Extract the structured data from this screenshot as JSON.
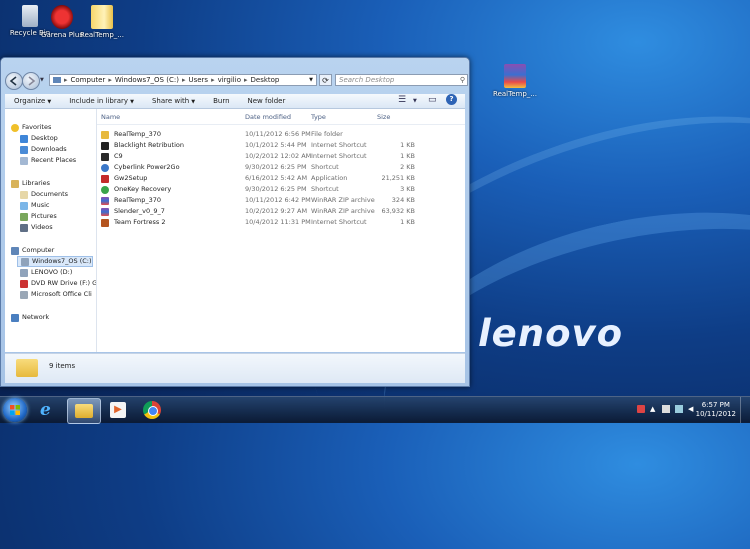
{
  "desktop": {
    "icons": [
      {
        "label": "Recycle Bin"
      },
      {
        "label": "Garena Plus"
      },
      {
        "label": "RealTemp_..."
      },
      {
        "label": "RealTemp_..."
      }
    ],
    "wallpaper_text": "lenovo"
  },
  "window": {
    "address": [
      "Computer",
      "Windows7_OS (C:)",
      "Users",
      "virgilio",
      "Desktop"
    ],
    "search_placeholder": "Search Desktop",
    "toolbar": {
      "organize": "Organize",
      "include": "Include in library",
      "share": "Share with",
      "burn": "Burn",
      "new_folder": "New folder"
    },
    "nav": {
      "favorites": "Favorites",
      "desktop": "Desktop",
      "downloads": "Downloads",
      "recent": "Recent Places",
      "libraries": "Libraries",
      "documents": "Documents",
      "music": "Music",
      "pictures": "Pictures",
      "videos": "Videos",
      "computer": "Computer",
      "c_drive": "Windows7_OS (C:)",
      "d_drive": "LENOVO (D:)",
      "f_drive": "DVD RW Drive (F:) G",
      "office": "Microsoft Office Cli",
      "network": "Network"
    },
    "columns": {
      "name": "Name",
      "date": "Date modified",
      "type": "Type",
      "size": "Size"
    },
    "files": [
      {
        "name": "RealTemp_370",
        "date": "10/11/2012 6:56 PM",
        "type": "File folder",
        "size": ""
      },
      {
        "name": "Blacklight Retribution",
        "date": "10/1/2012 5:44 PM",
        "type": "Internet Shortcut",
        "size": "1 KB"
      },
      {
        "name": "C9",
        "date": "10/2/2012 12:02 AM",
        "type": "Internet Shortcut",
        "size": "1 KB"
      },
      {
        "name": "Cyberlink Power2Go",
        "date": "9/30/2012 6:25 PM",
        "type": "Shortcut",
        "size": "2 KB"
      },
      {
        "name": "Gw2Setup",
        "date": "6/16/2012 5:42 AM",
        "type": "Application",
        "size": "21,251 KB"
      },
      {
        "name": "OneKey Recovery",
        "date": "9/30/2012 6:25 PM",
        "type": "Shortcut",
        "size": "3 KB"
      },
      {
        "name": "RealTemp_370",
        "date": "10/11/2012 6:42 PM",
        "type": "WinRAR ZIP archive",
        "size": "324 KB"
      },
      {
        "name": "Slender_v0_9_7",
        "date": "10/2/2012 9:27 AM",
        "type": "WinRAR ZIP archive",
        "size": "63,932 KB"
      },
      {
        "name": "Team Fortress 2",
        "date": "10/4/2012 11:31 PM",
        "type": "Internet Shortcut",
        "size": "1 KB"
      }
    ],
    "status": "9 items"
  },
  "taskbar": {
    "time": "6:57 PM",
    "date": "10/11/2012"
  },
  "colors": {
    "accent": "#1a5fb8",
    "folder": "#e7b93d"
  }
}
